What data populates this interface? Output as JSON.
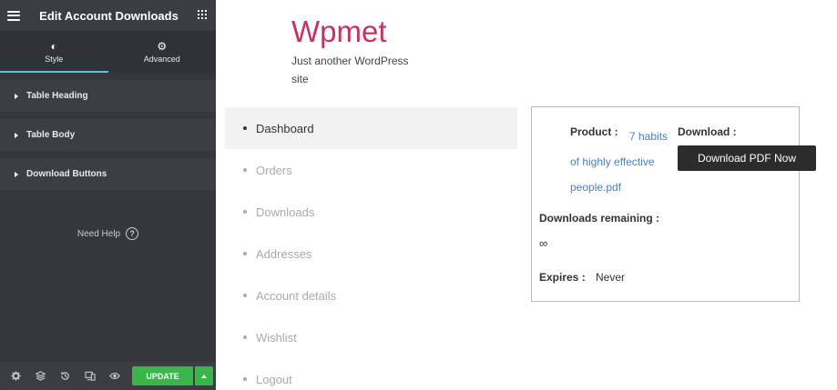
{
  "panel": {
    "title": "Edit Account Downloads",
    "tabs": [
      {
        "label": "Style",
        "icon": "contrast-icon"
      },
      {
        "label": "Advanced",
        "icon": "gear-icon"
      }
    ],
    "sections": [
      {
        "label": "Table Heading"
      },
      {
        "label": "Table Body"
      },
      {
        "label": "Download Buttons"
      }
    ],
    "help_label": "Need Help",
    "footer": {
      "icons": [
        "settings-icon",
        "layers-icon",
        "history-icon",
        "responsive-icon",
        "preview-eye-icon"
      ],
      "update_label": "UPDATE"
    },
    "accent_color": "#5bc0de",
    "update_color": "#39b54a"
  },
  "site": {
    "title": "Wpmet",
    "tagline": "Just another WordPress site",
    "title_color": "#c7335d"
  },
  "account_nav": {
    "items": [
      {
        "label": "Dashboard",
        "active": true
      },
      {
        "label": "Orders"
      },
      {
        "label": "Downloads"
      },
      {
        "label": "Addresses"
      },
      {
        "label": "Account details"
      },
      {
        "label": "Wishlist"
      },
      {
        "label": "Logout"
      }
    ]
  },
  "downloads_table": {
    "product_label": "Product :",
    "product_name": "7 habits of highly effective people.pdf",
    "download_label": "Download :",
    "download_button": "Download PDF Now",
    "remaining_label": "Downloads remaining :",
    "remaining_value": "∞",
    "expires_label": "Expires :",
    "expires_value": "Never"
  }
}
